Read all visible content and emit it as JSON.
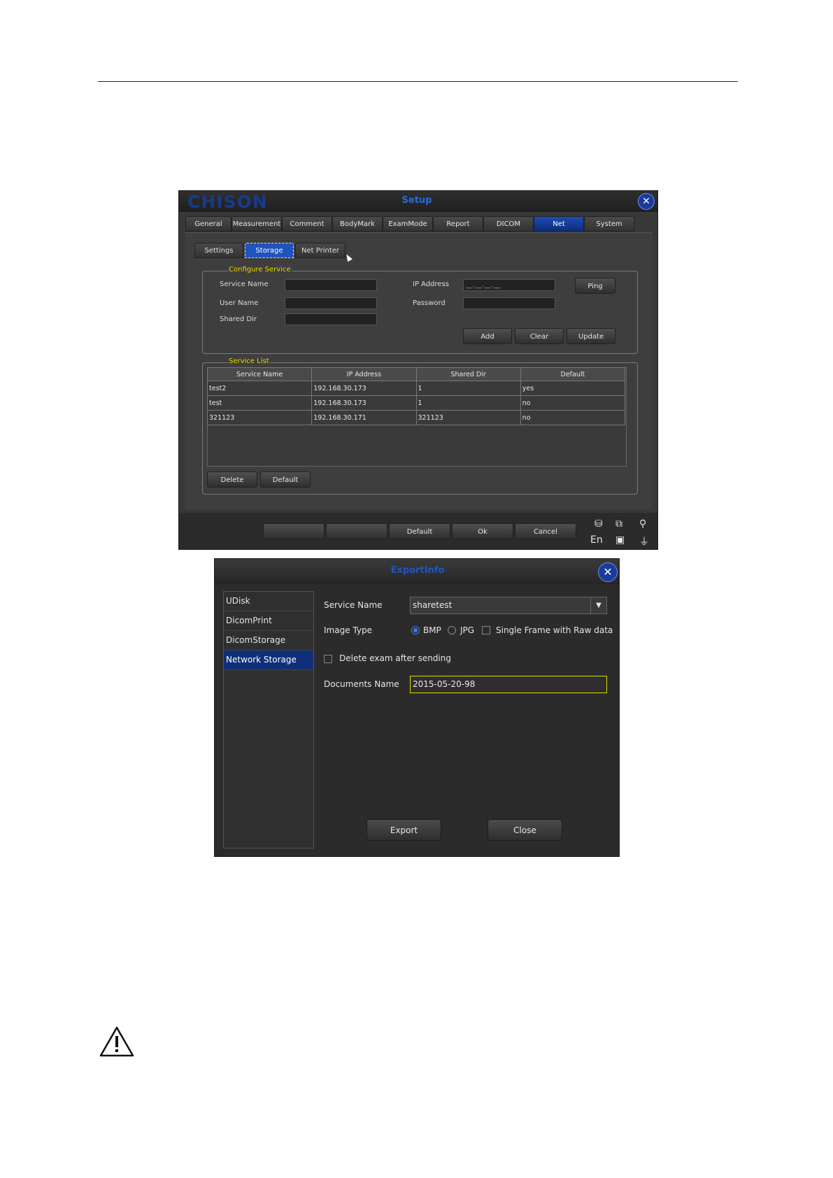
{
  "setup": {
    "brand": "CHISON",
    "title": "Setup",
    "close": "✕",
    "tabs": [
      "General",
      "Measurement",
      "Comment",
      "BodyMark",
      "ExamMode",
      "Report",
      "DICOM",
      "Net",
      "System"
    ],
    "active_tab": "Net",
    "subtabs": [
      "Settings",
      "Storage",
      "Net Printer"
    ],
    "active_subtab": "Storage",
    "configure": {
      "group_label": "Configure Service",
      "service_name_label": "Service Name",
      "user_name_label": "User Name",
      "shared_dir_label": "Shared Dir",
      "ip_address_label": "IP Address",
      "ip_placeholder": "__.__.__.__",
      "password_label": "Password",
      "ping": "Ping",
      "add": "Add",
      "clear": "Clear",
      "update": "Update"
    },
    "service_list": {
      "group_label": "Service List",
      "columns": [
        "Service Name",
        "IP Address",
        "Shared Dir",
        "Default"
      ],
      "rows": [
        [
          "test2",
          "192.168.30.173",
          "1",
          "yes"
        ],
        [
          "test",
          "192.168.30.173",
          "1",
          "no"
        ],
        [
          "321123",
          "192.168.30.171",
          "321123",
          "no"
        ]
      ],
      "delete": "Delete",
      "default": "Default"
    },
    "footer": {
      "default": "Default",
      "ok": "Ok",
      "cancel": "Cancel",
      "lang": "En"
    }
  },
  "export": {
    "title": "ExportInfo",
    "close": "✕",
    "sidebar": [
      "UDisk",
      "DicomPrint",
      "DicomStorage",
      "Network Storage"
    ],
    "active_sidebar": "Network Storage",
    "service_name_label": "Service Name",
    "service_name_value": "sharetest",
    "image_type_label": "Image Type",
    "bmp": "BMP",
    "jpg": "JPG",
    "bmp_selected": true,
    "single_frame_label": "Single Frame with Raw data",
    "delete_after_label": "Delete exam after sending",
    "documents_name_label": "Documents Name",
    "documents_name_value": "2015-05-20-98",
    "export_button": "Export",
    "close_button": "Close"
  }
}
